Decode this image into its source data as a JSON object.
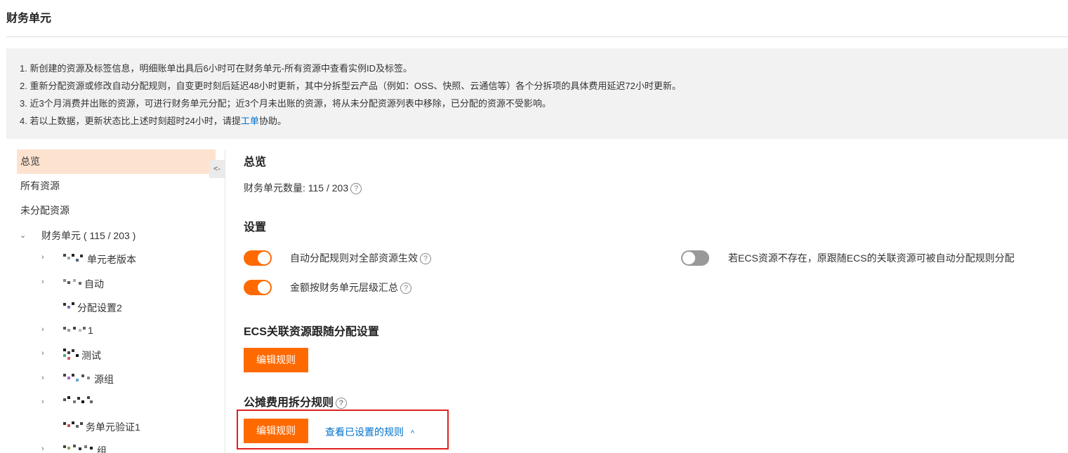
{
  "page": {
    "title": "财务单元"
  },
  "notice": {
    "line1": "1. 新创建的资源及标签信息，明细账单出具后6小时可在财务单元-所有资源中查看实例ID及标签。",
    "line2": "2. 重新分配资源或修改自动分配规则，自变更时刻后延迟48小时更新，其中分拆型云产品（例如：OSS、快照、云通信等）各个分拆项的具体费用延迟72小时更新。",
    "line3": "3. 近3个月消费并出账的资源，可进行财务单元分配；近3个月未出账的资源，将从未分配资源列表中移除，已分配的资源不受影响。",
    "line4_prefix": "4. 若以上数据，更新状态比上述时刻超时24小时，请提",
    "line4_link": "工单",
    "line4_suffix": "协助。"
  },
  "sidebar": {
    "overview": "总览",
    "all_resources": "所有资源",
    "unassigned": "未分配资源",
    "root": "财务单元 ( 115 / 203 )",
    "children": [
      {
        "label": "单元老版本",
        "caret": "›"
      },
      {
        "label": "自动",
        "caret": "›"
      },
      {
        "label": "分配设置2",
        "caret": ""
      },
      {
        "label": "1",
        "caret": "›"
      },
      {
        "label": "测试",
        "caret": "›"
      },
      {
        "label": "源组",
        "caret": "›"
      },
      {
        "label": "",
        "caret": "›"
      },
      {
        "label": "务单元验证1",
        "caret": ""
      },
      {
        "label": "组",
        "caret": "›"
      }
    ],
    "collapse_label": "<-"
  },
  "main": {
    "overview_title": "总览",
    "count_label": "财务单元数量: 115 / 203",
    "settings_title": "设置",
    "toggles": [
      {
        "label": "自动分配规则对全部资源生效",
        "on": true
      },
      {
        "label": "金额按财务单元层级汇总",
        "on": true
      },
      {
        "label": "若ECS资源不存在，原跟随ECS的关联资源可被自动分配规则分配",
        "on": false
      }
    ],
    "ecs_title": "ECS关联资源跟随分配设置",
    "edit_rule": "编辑规则",
    "split_title": "公摊费用拆分规则",
    "view_rules": "查看已设置的规则",
    "help_glyph": "?"
  },
  "colors": {
    "accent": "#ff6a00",
    "link": "#0070cc",
    "active_bg": "#fde3cf",
    "highlight": "#e02020"
  }
}
